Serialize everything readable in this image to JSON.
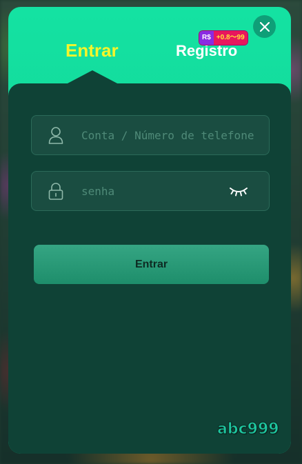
{
  "tabs": {
    "login_label": "Entrar",
    "register_label": "Registro"
  },
  "bonus_badge": {
    "currency": "R$",
    "amount": "+0.8～99"
  },
  "form": {
    "account_placeholder": "Conta / Número de telefone",
    "password_placeholder": "senha",
    "submit_label": "Entrar"
  },
  "brand": {
    "logo_text": "abc999"
  },
  "icons": {
    "close": "close-icon",
    "user": "user-icon",
    "lock": "lock-icon",
    "eye": "eye-closed-icon"
  },
  "colors": {
    "header_gradient_top": "#14e2a2",
    "panel_bg": "#0f4236",
    "active_tab": "#f6f52a",
    "button": "#2a9c79"
  }
}
